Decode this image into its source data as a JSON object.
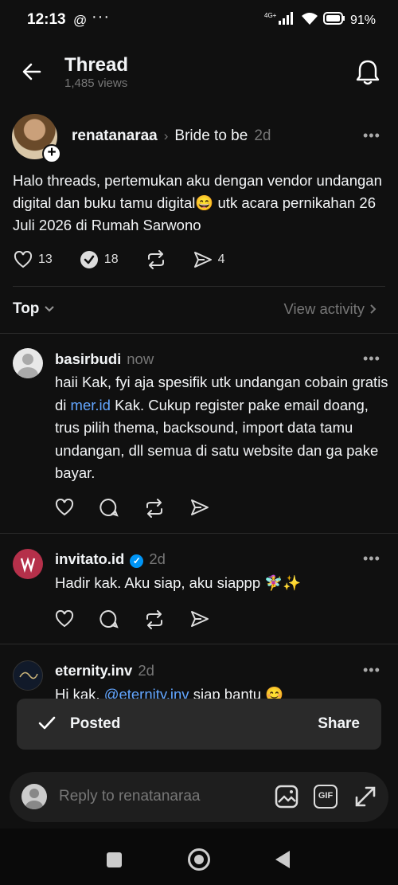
{
  "status_bar": {
    "time": "12:13",
    "app_icon": "@",
    "dots": "···",
    "network": "4G+",
    "battery": "91%"
  },
  "header": {
    "title": "Thread",
    "views": "1,485 views"
  },
  "post": {
    "username": "renatanaraa",
    "topic": "Bride to be",
    "time": "2d",
    "text": "Halo threads, pertemukan aku dengan vendor undangan digital dan buku tamu digital😄 utk acara pernikahan 26 Juli 2026 di Rumah Sarwono",
    "likes": "13",
    "reposts": "18",
    "shares": "4"
  },
  "sort": {
    "label": "Top",
    "view_activity": "View activity"
  },
  "replies": [
    {
      "username": "basirbudi",
      "time": "now",
      "text_before": "haii Kak, fyi aja spesifik utk undangan cobain gratis di ",
      "link": "mer.id",
      "text_after": " Kak. Cukup register pake email doang, trus pilih thema, backsound, import data tamu undangan, dll semua di satu website dan ga pake bayar."
    },
    {
      "username": "invitato.id",
      "time": "2d",
      "text": "Hadir kak. Aku siap, aku siappp 🧚‍♀️✨"
    },
    {
      "username": "eternity.inv",
      "time": "2d",
      "text_before": "Hi kak, ",
      "mention": "@eternity.inv",
      "text_after": " siap bantu 😊"
    }
  ],
  "toast": {
    "text": "Posted",
    "action": "Share"
  },
  "reply_bar": {
    "placeholder": "Reply to renatanaraa",
    "gif_label": "GIF"
  }
}
